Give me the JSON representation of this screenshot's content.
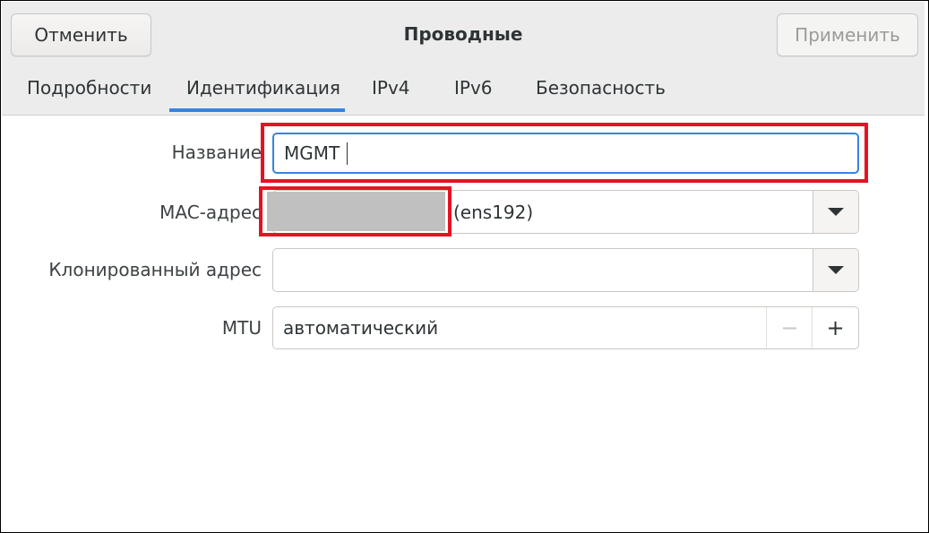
{
  "header": {
    "cancel_label": "Отменить",
    "title": "Проводные",
    "apply_label": "Применить"
  },
  "tabs": [
    {
      "label": "Подробности",
      "active": false
    },
    {
      "label": "Идентификация",
      "active": true
    },
    {
      "label": "IPv4",
      "active": false
    },
    {
      "label": "IPv6",
      "active": false
    },
    {
      "label": "Безопасность",
      "active": false
    }
  ],
  "form": {
    "name_label": "Название",
    "name_value": "MGMT",
    "mac_label": "MAC-адрес",
    "mac_suffix": "(ens192)",
    "cloned_label": "Клонированный адрес",
    "cloned_value": "",
    "mtu_label": "MTU",
    "mtu_value": "автоматический",
    "mtu_minus": "−",
    "mtu_plus": "+"
  },
  "colors": {
    "accent": "#3584e4",
    "highlight": "#e81123"
  }
}
